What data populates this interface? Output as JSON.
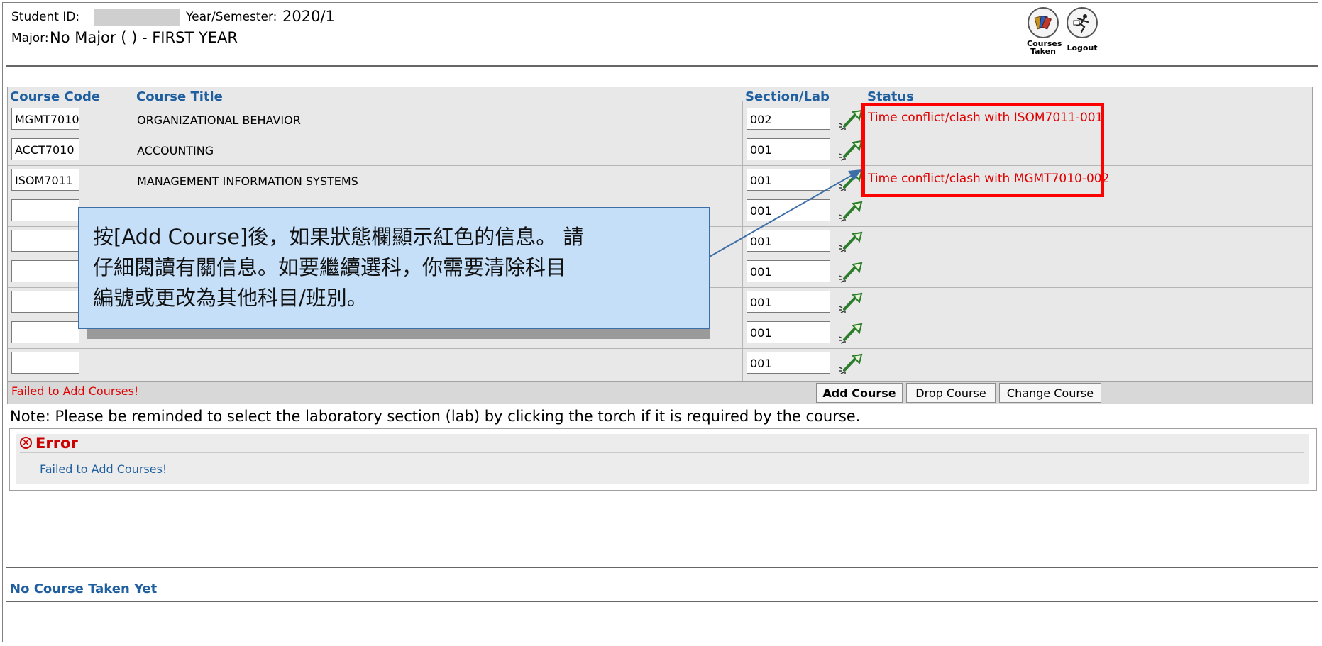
{
  "header": {
    "student_id_label": "Student ID:",
    "year_semester_label": "Year/Semester:",
    "year_semester_value": "2020/1",
    "major_label": "Major:",
    "major_value": "No Major ( ) - FIRST YEAR"
  },
  "nav": {
    "courses_taken_label_line1": "Courses",
    "courses_taken_label_line2": "Taken",
    "logout_label": "Logout"
  },
  "table": {
    "columns": {
      "course_code": "Course Code",
      "course_title": "Course Title",
      "section_lab": "Section/Lab",
      "status": "Status"
    },
    "rows": [
      {
        "code": "MGMT7010",
        "title": "ORGANIZATIONAL BEHAVIOR",
        "section": "002",
        "status": "Time conflict/clash with ISOM7011-001"
      },
      {
        "code": "ACCT7010",
        "title": "ACCOUNTING",
        "section": "001",
        "status": ""
      },
      {
        "code": "ISOM7011",
        "title": "MANAGEMENT INFORMATION SYSTEMS",
        "section": "001",
        "status": "Time conflict/clash with MGMT7010-002"
      },
      {
        "code": "",
        "title": "",
        "section": "001",
        "status": ""
      },
      {
        "code": "",
        "title": "",
        "section": "001",
        "status": ""
      },
      {
        "code": "",
        "title": "",
        "section": "001",
        "status": ""
      },
      {
        "code": "",
        "title": "",
        "section": "001",
        "status": ""
      },
      {
        "code": "",
        "title": "",
        "section": "001",
        "status": ""
      },
      {
        "code": "",
        "title": "",
        "section": "001",
        "status": ""
      }
    ],
    "footer_message": "Failed to Add Courses!",
    "buttons": {
      "add": "Add Course",
      "drop": "Drop Course",
      "change": "Change Course"
    }
  },
  "note": "Note: Please be reminded to select the laboratory section (lab) by clicking the torch if it is required by the course.",
  "error": {
    "title": "Error",
    "message": "Failed to Add Courses!"
  },
  "taken": {
    "heading": "No Course Taken Yet"
  },
  "callout": {
    "line1": "按[Add Course]後，如果狀態欄顯示紅色的信息。 請",
    "line2": "仔細閱讀有關信息。如要繼續選科，你需要清除科目",
    "line3": "編號或更改為其他科目/班別。"
  },
  "colors": {
    "header_blue": "#1f5f9f",
    "error_red": "#e00000",
    "highlight_red": "#ff0000",
    "callout_bg": "#c5dff9"
  }
}
